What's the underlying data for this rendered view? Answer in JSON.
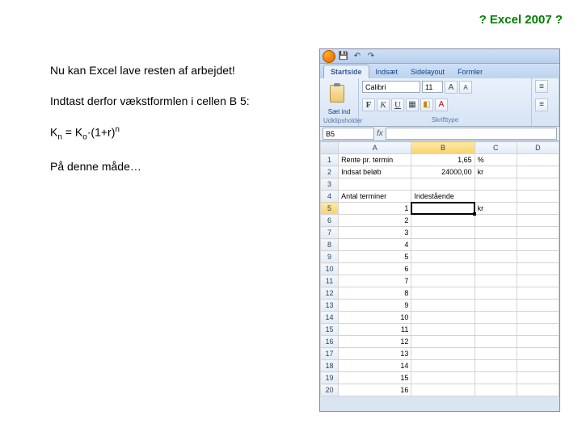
{
  "title": "? Excel 2007 ?",
  "text": {
    "p1": "Nu kan Excel lave resten af arbejdet!",
    "p2": "Indtast derfor vækstformlen i cellen B 5:",
    "p4": "På denne måde…"
  },
  "formula": {
    "Kn": "K",
    "n_sub": "n",
    "eq": " = K",
    "o_sub": "o",
    "mid": "·(1+r)",
    "n_sup": "n"
  },
  "excel": {
    "tabs": [
      "Startside",
      "Indsæt",
      "Sidelayout",
      "Formler"
    ],
    "active_tab": 0,
    "ribbon": {
      "paste": "Sæt ind",
      "clipboard_label": "Udklipsholder",
      "font_name": "Calibri",
      "font_size": "11",
      "font_label": "Skrifttype"
    },
    "namebox": "B5",
    "columns": [
      "A",
      "B",
      "C",
      "D"
    ],
    "rows": [
      {
        "n": 1,
        "A": "Rente pr. termin",
        "B": "1,65",
        "C": "%"
      },
      {
        "n": 2,
        "A": "Indsat beløb",
        "B": "24000,00",
        "C": "kr"
      },
      {
        "n": 3,
        "A": "",
        "B": ""
      },
      {
        "n": 4,
        "A": "Antal terminer",
        "B": "Indestående"
      },
      {
        "n": 5,
        "A": "1",
        "B": "",
        "C": "kr",
        "selected": true
      },
      {
        "n": 6,
        "A": "2",
        "B": ""
      },
      {
        "n": 7,
        "A": "3"
      },
      {
        "n": 8,
        "A": "4"
      },
      {
        "n": 9,
        "A": "5"
      },
      {
        "n": 10,
        "A": "6"
      },
      {
        "n": 11,
        "A": "7"
      },
      {
        "n": 12,
        "A": "8"
      },
      {
        "n": 13,
        "A": "9"
      },
      {
        "n": 14,
        "A": "10"
      },
      {
        "n": 15,
        "A": "11"
      },
      {
        "n": 16,
        "A": "12"
      },
      {
        "n": 17,
        "A": "13"
      },
      {
        "n": 18,
        "A": "14"
      },
      {
        "n": 19,
        "A": "15"
      },
      {
        "n": 20,
        "A": "16"
      }
    ]
  }
}
